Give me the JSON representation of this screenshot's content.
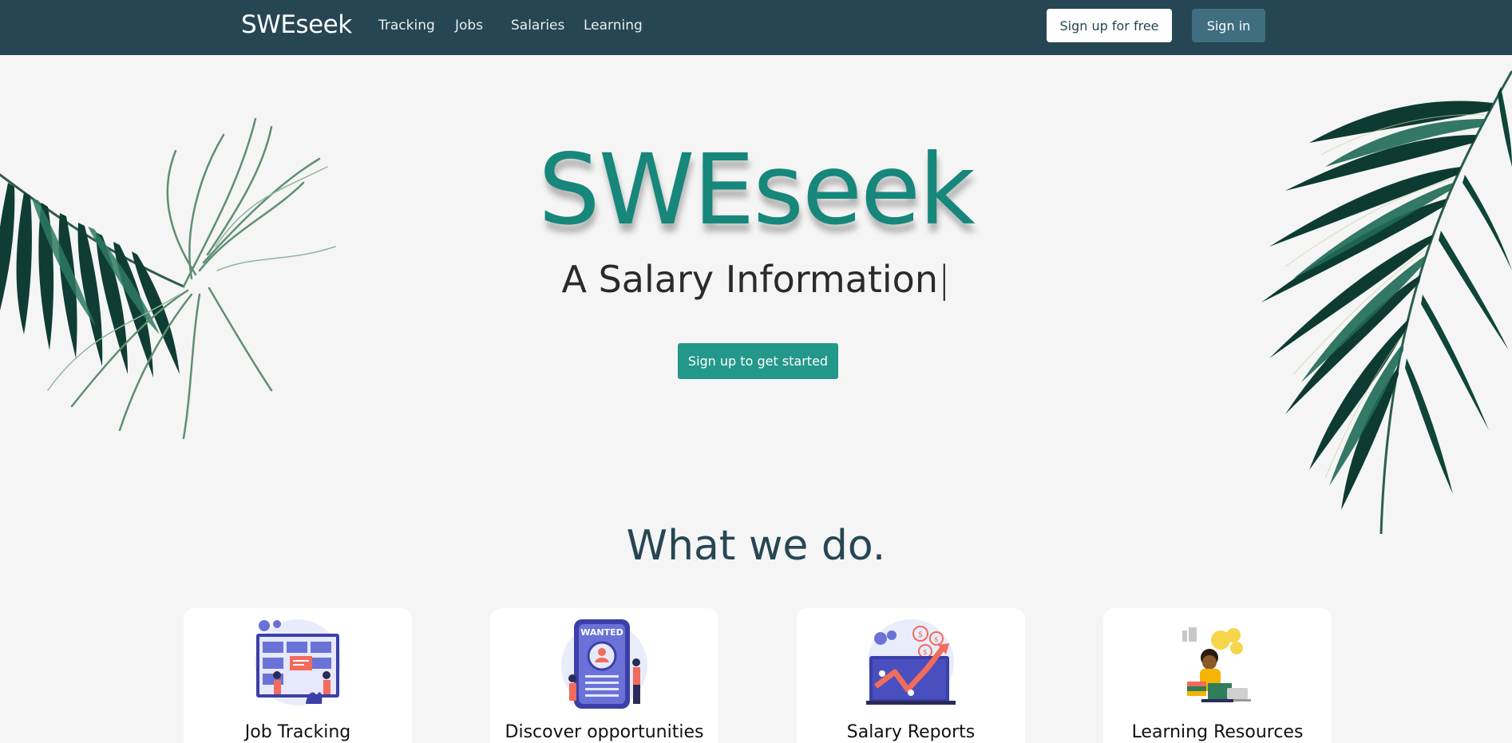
{
  "navbar": {
    "brand": "SWEseek",
    "links": [
      {
        "label": "Tracking"
      },
      {
        "label": "Jobs"
      },
      {
        "label": "Salaries"
      },
      {
        "label": "Learning"
      }
    ],
    "signup_label": "Sign up for free",
    "signin_label": "Sign in"
  },
  "hero": {
    "title": "SWEseek",
    "subtitle": "A Salary Information",
    "cursor": "|",
    "cta_label": "Sign up to get started"
  },
  "features": {
    "heading": "What we do.",
    "cards": [
      {
        "title": "Job Tracking",
        "icon": "job-tracking-illustration"
      },
      {
        "title": "Discover opportunities",
        "icon": "wanted-poster-illustration",
        "badge": "WANTED"
      },
      {
        "title": "Salary Reports",
        "icon": "salary-chart-illustration"
      },
      {
        "title": "Learning Resources",
        "icon": "learning-resources-illustration"
      }
    ]
  },
  "colors": {
    "navbar_bg": "#264653",
    "accent_teal": "#23978a",
    "title_teal": "#16877a",
    "signin_bg": "#3f6e80",
    "page_bg": "#f5f5f5"
  }
}
